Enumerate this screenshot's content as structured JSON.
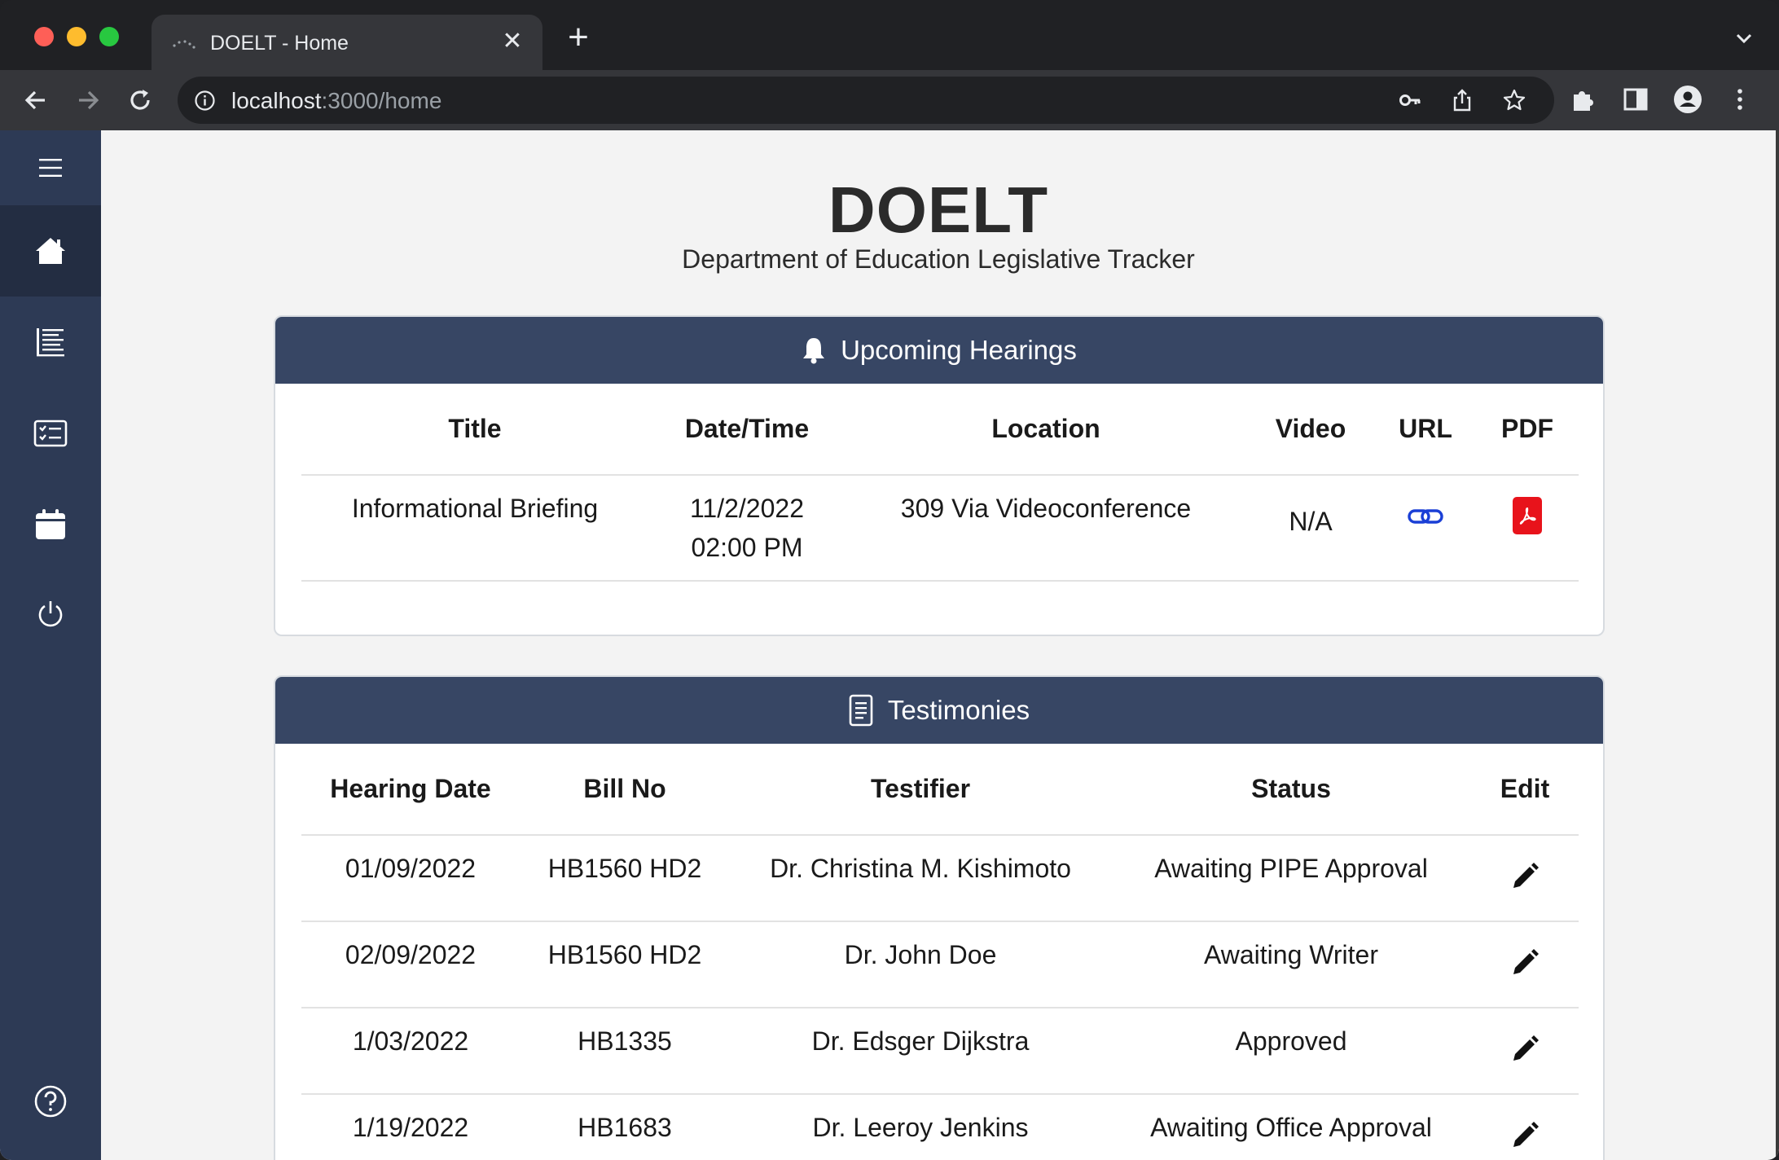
{
  "browser": {
    "tab_title": "DOELT - Home",
    "url_host": "localhost",
    "url_rest": ":3000/home"
  },
  "app": {
    "title": "DOELT",
    "subtitle": "Department of Education Legislative Tracker"
  },
  "sidebar": {
    "items": [
      {
        "name": "menu",
        "icon": "hamburger-icon"
      },
      {
        "name": "home",
        "icon": "home-icon",
        "active": true
      },
      {
        "name": "bills",
        "icon": "list-icon"
      },
      {
        "name": "testimonies",
        "icon": "checklist-icon"
      },
      {
        "name": "calendar",
        "icon": "calendar-icon"
      },
      {
        "name": "logout",
        "icon": "power-icon"
      },
      {
        "name": "help",
        "icon": "help-icon"
      }
    ]
  },
  "hearings": {
    "header": "Upcoming Hearings",
    "columns": [
      "Title",
      "Date/Time",
      "Location",
      "Video",
      "URL",
      "PDF"
    ],
    "rows": [
      {
        "title": "Informational Briefing",
        "date": "11/2/2022",
        "time": "02:00 PM",
        "location": "309 Via Videoconference",
        "video": "N/A",
        "url_icon": "link-icon",
        "pdf_icon": "pdf-icon"
      }
    ]
  },
  "testimonies": {
    "header": "Testimonies",
    "columns": [
      "Hearing Date",
      "Bill No",
      "Testifier",
      "Status",
      "Edit"
    ],
    "rows": [
      {
        "date": "01/09/2022",
        "bill": "HB1560 HD2",
        "testifier": "Dr. Christina M. Kishimoto",
        "status": "Awaiting PIPE Approval"
      },
      {
        "date": "02/09/2022",
        "bill": "HB1560 HD2",
        "testifier": "Dr. John Doe",
        "status": "Awaiting Writer"
      },
      {
        "date": "1/03/2022",
        "bill": "HB1335",
        "testifier": "Dr. Edsger Dijkstra",
        "status": "Approved"
      },
      {
        "date": "1/19/2022",
        "bill": "HB1683",
        "testifier": "Dr. Leeroy Jenkins",
        "status": "Awaiting Office Approval"
      }
    ]
  },
  "colors": {
    "sidebar": "#2d3a55",
    "header": "#374664",
    "pdf": "#e8131b",
    "link": "#1a3fd6"
  }
}
